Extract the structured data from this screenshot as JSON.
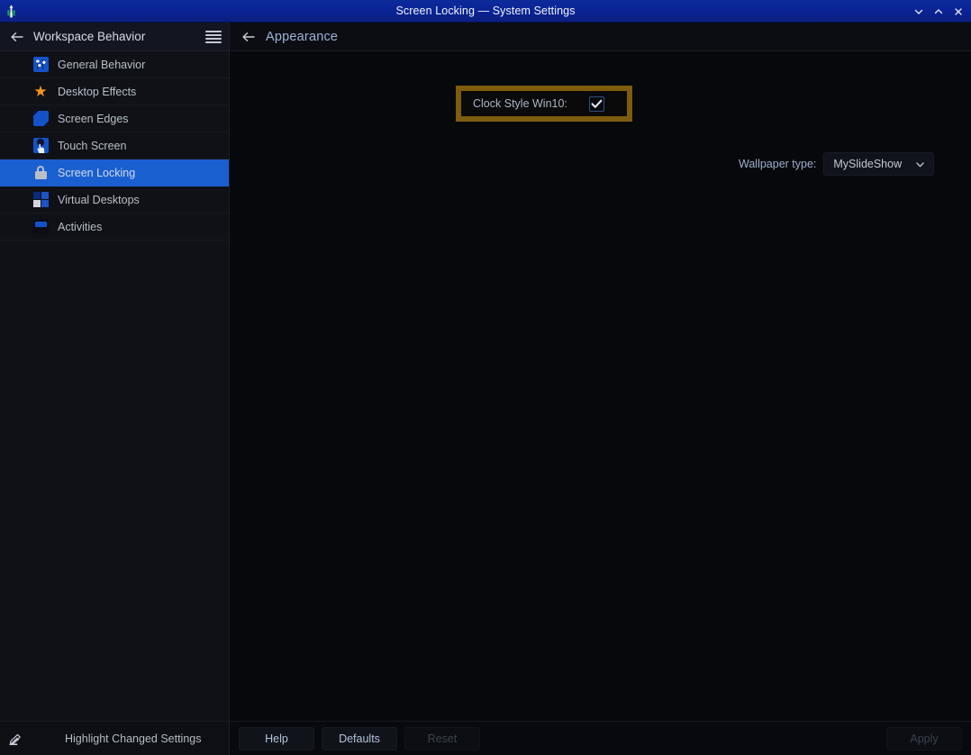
{
  "titlebar": {
    "title": "Screen Locking — System Settings",
    "app_icon": "kde-app-icon",
    "buttons": [
      {
        "name": "minimize-button",
        "icon": "chevron-down-icon"
      },
      {
        "name": "maximize-button",
        "icon": "chevron-up-icon"
      },
      {
        "name": "close-button",
        "icon": "close-icon"
      }
    ]
  },
  "sidebar": {
    "back_icon": "arrow-left-icon",
    "title": "Workspace Behavior",
    "menu_icon": "hamburger-menu-icon",
    "items": [
      {
        "label": "General Behavior",
        "icon": "sliders-icon",
        "selected": false
      },
      {
        "label": "Desktop Effects",
        "icon": "star-icon",
        "selected": false
      },
      {
        "label": "Screen Edges",
        "icon": "screen-edges-icon",
        "selected": false
      },
      {
        "label": "Touch Screen",
        "icon": "touch-hand-icon",
        "selected": false
      },
      {
        "label": "Screen Locking",
        "icon": "lock-icon",
        "selected": true
      },
      {
        "label": "Virtual Desktops",
        "icon": "grid-squares-icon",
        "selected": false
      },
      {
        "label": "Activities",
        "icon": "activities-icon",
        "selected": false
      }
    ],
    "footer": {
      "icon": "highlighter-pen-icon",
      "label": "Highlight Changed Settings"
    }
  },
  "content": {
    "back_icon": "arrow-left-icon",
    "title": "Appearance",
    "highlight_color": "#7d5c0d",
    "clock_style": {
      "label": "Clock Style Win10:",
      "checked": true,
      "check_icon": "checkmark-icon"
    },
    "wallpaper": {
      "label": "Wallpaper type:",
      "value": "MySlideShow",
      "arrow_icon": "chevron-down-icon"
    }
  },
  "bottombar": {
    "help_label": "Help",
    "defaults_label": "Defaults",
    "reset_label": "Reset",
    "apply_label": "Apply"
  }
}
